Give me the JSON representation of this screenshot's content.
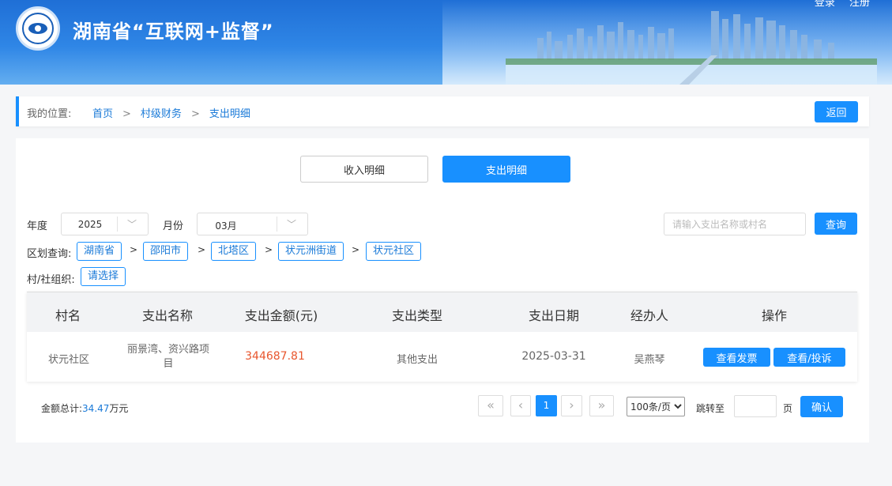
{
  "header": {
    "site_title": "湖南省“互联网+监督”",
    "login": "登录",
    "register": "注册"
  },
  "breadcrumb": {
    "label": "我的位置:",
    "items": [
      "首页",
      "村级财务",
      "支出明细"
    ],
    "separator": ">",
    "back_label": "返回"
  },
  "tabs": {
    "income": "收入明细",
    "expense": "支出明细",
    "active": "expense"
  },
  "filters": {
    "year_label": "年度",
    "year_value": "2025",
    "month_label": "月份",
    "month_value": "03月",
    "search_placeholder": "请输入支出名称或村名",
    "query_label": "查询",
    "region_label": "区划查询:",
    "regions": [
      "湖南省",
      "邵阳市",
      "北塔区",
      "状元洲街道",
      "状元社区"
    ],
    "region_separator": ">",
    "org_label": "村/社组织:",
    "org_value": "请选择"
  },
  "table": {
    "headers": [
      "村名",
      "支出名称",
      "支出金额(元)",
      "支出类型",
      "支出日期",
      "经办人",
      "操作"
    ],
    "rows": [
      {
        "village": "状元社区",
        "name_line1": "丽景湾、资兴路项",
        "name_line2": "目",
        "amount": "344687.81",
        "type": "其他支出",
        "date": "2025-03-31",
        "handler": "吴燕琴",
        "action_invoice": "查看发票",
        "action_view": "查看/投诉"
      }
    ]
  },
  "footer": {
    "total_label": "金额总计:",
    "total_value": "34.47",
    "total_unit": "万元",
    "first_icon": "«",
    "prev_icon": "‹",
    "current_page": "1",
    "next_icon": "›",
    "last_icon": "»",
    "page_size": "100条/页",
    "jump_label": "跳转至",
    "page_unit": "页",
    "confirm_label": "确认"
  },
  "colors": {
    "primary": "#1890ff",
    "amount": "#e8562d",
    "header_top": "#1f6fd6"
  }
}
